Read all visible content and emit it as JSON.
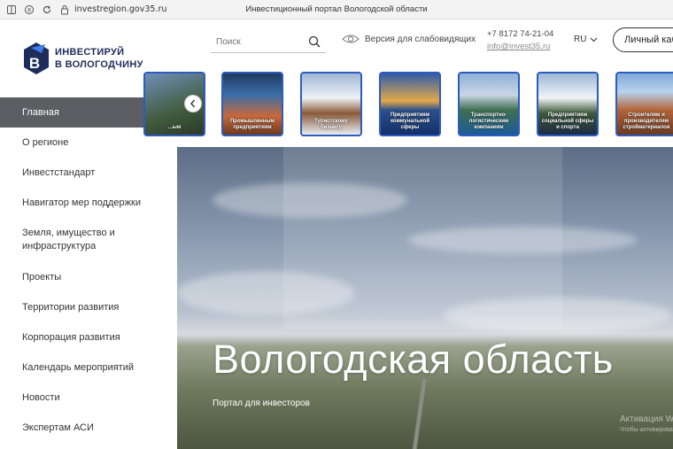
{
  "browser": {
    "url": "investregion.gov35.ru",
    "tab_title": "Инвестиционный портал Вологодской области"
  },
  "logo": {
    "line1": "ИНВЕСТИРУЙ",
    "line2": "В ВОЛОГОДЧИНУ",
    "brand_color": "#1d2c5a"
  },
  "sidebar": {
    "items": [
      {
        "label": "Главная",
        "active": true
      },
      {
        "label": "О регионе"
      },
      {
        "label": "Инвестстандарт"
      },
      {
        "label": "Навигатор мер поддержки"
      },
      {
        "label": "Земля, имущество и инфраструктура"
      },
      {
        "label": "Проекты"
      },
      {
        "label": "Территории развития"
      },
      {
        "label": "Корпорация развития"
      },
      {
        "label": "Календарь мероприятий"
      },
      {
        "label": "Новости"
      },
      {
        "label": "Экспертам АСИ"
      }
    ]
  },
  "header": {
    "search_placeholder": "Поиск",
    "accessible_label": "Версия для слабовидящих",
    "phone": "+7 8172 74-21-04",
    "email": "info@invest35.ru",
    "lang": "RU",
    "cabinet_label": "Личный кабинет"
  },
  "cards": [
    {
      "label": "...ым"
    },
    {
      "label": "Промышленным предприятиям"
    },
    {
      "label": "Туристскому бизнесу"
    },
    {
      "label": "Предприятиям коммунальной сферы"
    },
    {
      "label": "Транспортно-логистическим компаниям"
    },
    {
      "label": "Предприятиям социальной сферы и спорта"
    },
    {
      "label": "Строителям и производителям стройматериалов"
    }
  ],
  "hero": {
    "title": "Вологодская область",
    "subtitle": "Портал для инвесторов",
    "watermark_line1": "Активация Windows",
    "watermark_line2": "Чтобы активировать Windows, перейдите в раздел «Параметры»."
  },
  "colors": {
    "accent_blue": "#2e5bbf",
    "active_menu_bg": "#5c5e63"
  }
}
